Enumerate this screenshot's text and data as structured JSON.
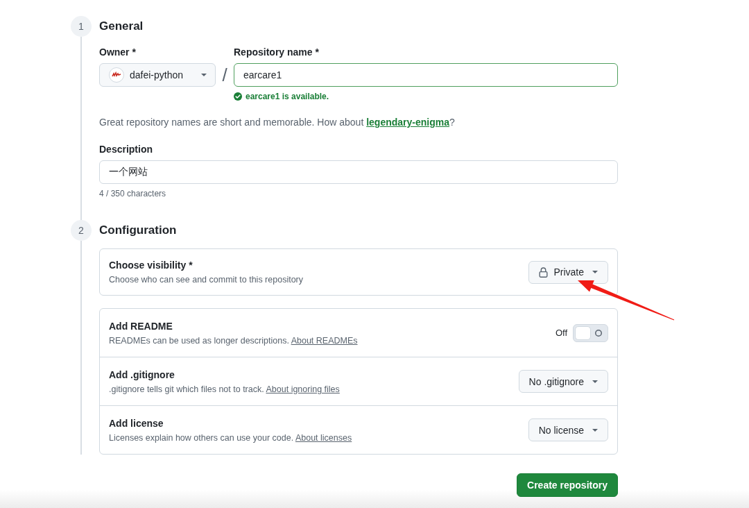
{
  "general": {
    "step": "1",
    "title": "General",
    "owner": {
      "label": "Owner *",
      "value": "dafei-python"
    },
    "separator": "/",
    "repository_name": {
      "label": "Repository name *",
      "value": "earcare1",
      "valid": true,
      "status": "earcare1 is available."
    },
    "hint": {
      "before": "Great repository names are short and memorable. How about ",
      "link": "legendary-enigma",
      "after": "?"
    },
    "description": {
      "label": "Description",
      "value": "一个网站",
      "counter": "4 / 350 characters"
    }
  },
  "configuration": {
    "step": "2",
    "title": "Configuration",
    "visibility": {
      "title": "Choose visibility *",
      "subtitle": "Choose who can see and commit to this repository",
      "value": "Private"
    },
    "options": [
      {
        "kind": "toggle",
        "title": "Add README",
        "text": "READMEs can be used as longer descriptions.",
        "link": "About READMEs",
        "state_label": "Off",
        "on": false
      },
      {
        "kind": "dropdown",
        "title": "Add .gitignore",
        "text": ".gitignore tells git which files not to track.",
        "link": "About ignoring files",
        "value": "No .gitignore"
      },
      {
        "kind": "dropdown",
        "title": "Add license",
        "text": "Licenses explain how others can use your code.",
        "link": "About licenses",
        "value": "No license"
      }
    ]
  },
  "submit": "Create repository"
}
